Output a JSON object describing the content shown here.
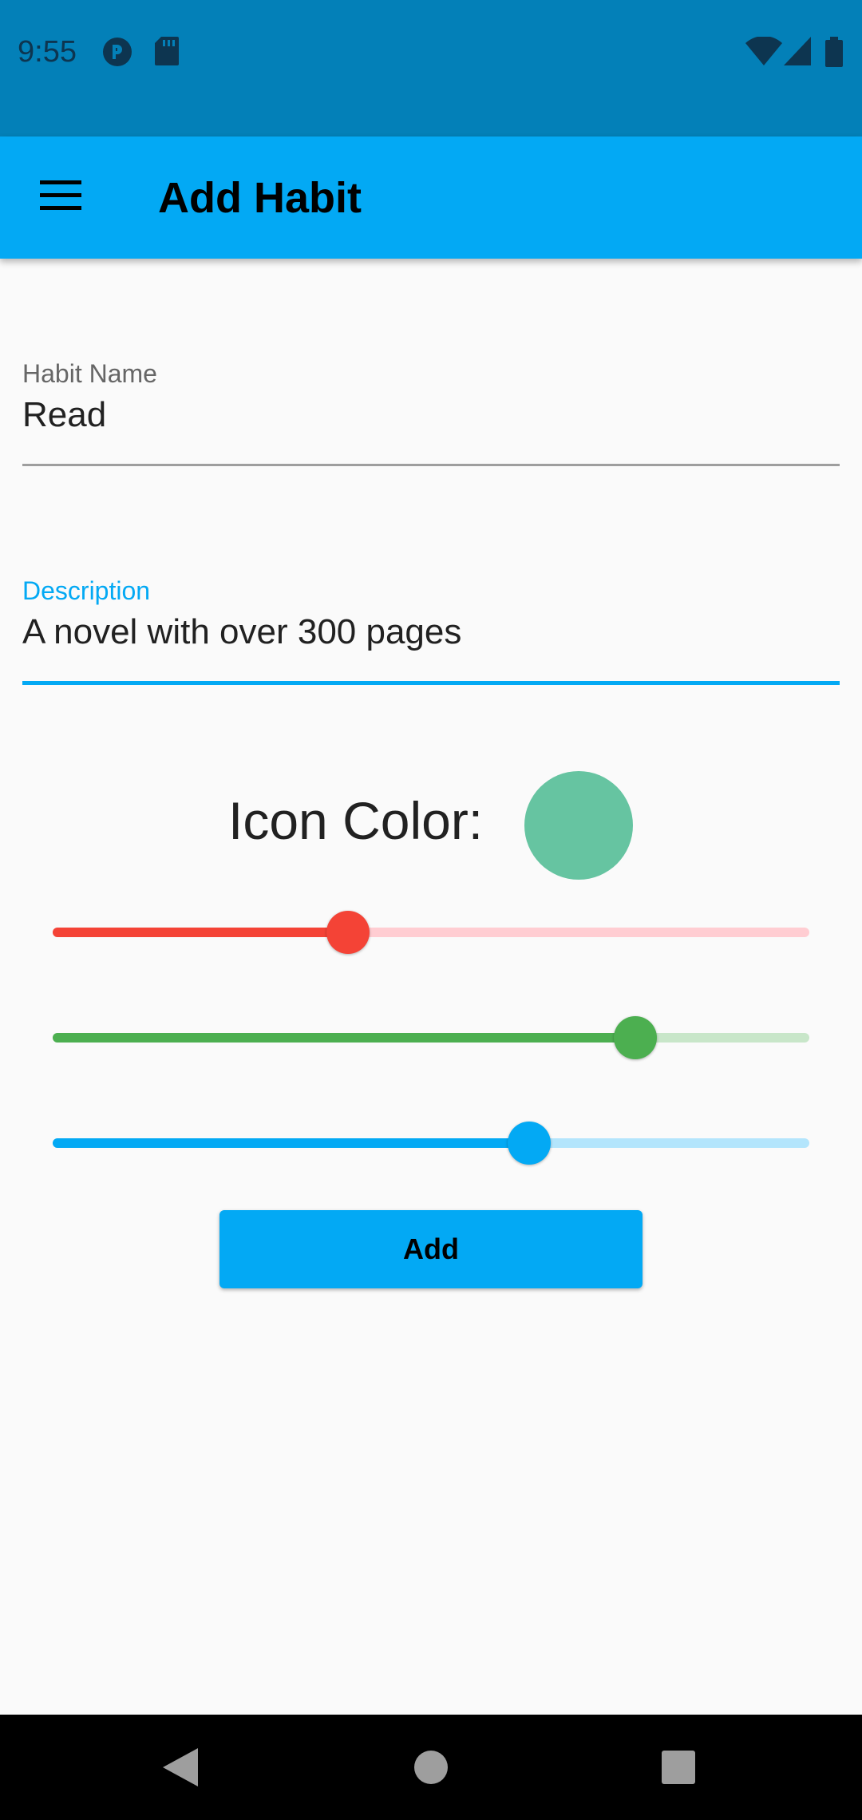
{
  "status_bar": {
    "time": "9:55",
    "left_icons": [
      "notification-app-icon",
      "sd-card-icon"
    ],
    "right_icons": [
      "wifi-icon",
      "cell-signal-icon",
      "battery-icon"
    ]
  },
  "app_bar": {
    "title": "Add Habit",
    "menu_icon": "menu-icon"
  },
  "form": {
    "habit_name": {
      "label": "Habit Name",
      "value": "Read"
    },
    "description": {
      "label": "Description",
      "value": "A novel with over 300 pages",
      "focused": true
    }
  },
  "icon_color": {
    "label": "Icon Color:",
    "swatch_color": "#66c4a1",
    "sliders": [
      {
        "name": "red",
        "level": 0.39,
        "active_color": "#f44336",
        "inactive_color": "#ffcdd2"
      },
      {
        "name": "green",
        "level": 0.77,
        "active_color": "#4caf50",
        "inactive_color": "#c8e6c9"
      },
      {
        "name": "blue",
        "level": 0.63,
        "active_color": "#03a9f4",
        "inactive_color": "#b3e5fc"
      }
    ]
  },
  "add_button": {
    "label": "Add"
  },
  "colors": {
    "accent": "#03a9f4",
    "status_bar": "#0380b8"
  },
  "nav_bar": {
    "icons": [
      "back-icon",
      "home-icon",
      "recents-icon"
    ]
  }
}
